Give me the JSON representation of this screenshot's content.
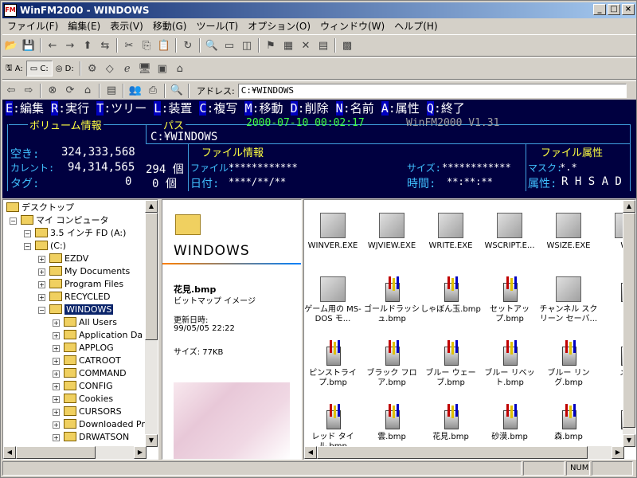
{
  "window": {
    "title": "WinFM2000 - WINDOWS",
    "minimize": "_",
    "maximize": "□",
    "close": "×"
  },
  "menu": [
    "ファイル(F)",
    "編集(E)",
    "表示(V)",
    "移動(G)",
    "ツール(T)",
    "オプション(O)",
    "ウィンドウ(W)",
    "ヘルプ(H)"
  ],
  "drives": {
    "a": "A:",
    "c": "C:",
    "d": "D:"
  },
  "address": {
    "label": "アドレス:",
    "value": "C:¥WINDOWS"
  },
  "commands": [
    {
      "key": "E",
      "label": ":編集"
    },
    {
      "key": "R",
      "label": ":実行"
    },
    {
      "key": "T",
      "label": ":ツリー"
    },
    {
      "key": "L",
      "label": ":装置"
    },
    {
      "key": "C",
      "label": ":複写"
    },
    {
      "key": "M",
      "label": ":移動"
    },
    {
      "key": "D",
      "label": ":削除"
    },
    {
      "key": "N",
      "label": ":名前"
    },
    {
      "key": "A",
      "label": ":属性"
    },
    {
      "key": "Q",
      "label": ":終了"
    }
  ],
  "info": {
    "volume_label": "ボリューム情報",
    "path_label": "パス",
    "datetime": "2000-07-10 00:02:17",
    "version": "WinFM2000 V1.31",
    "path": "C:¥WINDOWS",
    "free_label": "空き:",
    "free_value": "324,333,568",
    "current_label": "カレント:",
    "current_value": "94,314,565",
    "current_count": "294 個",
    "tag_label": "タグ:",
    "tag_value": "0",
    "tag_count": "0 個",
    "fileinfo_label": "ファイル情報",
    "file_label": "ファイル:",
    "file_value": "************",
    "date_label": "日付:",
    "date_value": "****/**/**",
    "size_label": "サイズ:",
    "size_value": "************",
    "time_label": "時間:",
    "time_value": "**:**:**",
    "attr_title": "ファイル属性",
    "mask_label": "マスク:",
    "mask_value": "*.*",
    "attr_label": "属性:",
    "attr_value": "R H S A D"
  },
  "tree": [
    {
      "label": "デスクトップ",
      "level": 0
    },
    {
      "label": "マイ コンピュータ",
      "level": 1
    },
    {
      "label": "3.5 インチ FD (A:)",
      "level": 2
    },
    {
      "label": "(C:)",
      "level": 2
    },
    {
      "label": "EZDV",
      "level": 3
    },
    {
      "label": "My Documents",
      "level": 3
    },
    {
      "label": "Program Files",
      "level": 3
    },
    {
      "label": "RECYCLED",
      "level": 3
    },
    {
      "label": "WINDOWS",
      "level": 3,
      "selected": true
    },
    {
      "label": "All Users",
      "level": 4
    },
    {
      "label": "Application Da",
      "level": 4
    },
    {
      "label": "APPLOG",
      "level": 4
    },
    {
      "label": "CATROOT",
      "level": 4
    },
    {
      "label": "COMMAND",
      "level": 4
    },
    {
      "label": "CONFIG",
      "level": 4
    },
    {
      "label": "Cookies",
      "level": 4
    },
    {
      "label": "CURSORS",
      "level": 4
    },
    {
      "label": "Downloaded Pr",
      "level": 4
    },
    {
      "label": "DRWATSON",
      "level": 4
    }
  ],
  "preview": {
    "folder_name": "WINDOWS",
    "file_name": "花見.bmp",
    "file_type": "ビットマップ イメージ",
    "modified_label": "更新日時:",
    "modified_value": "99/05/05 22:22",
    "size_text": "サイズ: 77KB"
  },
  "files": [
    {
      "name": "WINVER.EXE",
      "type": "exe"
    },
    {
      "name": "WJVIEW.EXE",
      "type": "exe"
    },
    {
      "name": "WRITE.EXE",
      "type": "exe"
    },
    {
      "name": "WSCRIPT.E...",
      "type": "exe"
    },
    {
      "name": "WSIZE.EXE",
      "type": "exe"
    },
    {
      "name": "WU",
      "type": "exe"
    },
    {
      "name": "ゲーム用の MS-DOS モ...",
      "type": "exe"
    },
    {
      "name": "ゴールドラッシュ.bmp",
      "type": "bmp"
    },
    {
      "name": "しゃぼん玉.bmp",
      "type": "bmp"
    },
    {
      "name": "セットアップ.bmp",
      "type": "bmp"
    },
    {
      "name": "チャンネル スクリーン セーバ...",
      "type": "exe"
    },
    {
      "name": "ト",
      "type": "bmp"
    },
    {
      "name": "ピンストライプ.bmp",
      "type": "bmp"
    },
    {
      "name": "ブラック フロア.bmp",
      "type": "bmp"
    },
    {
      "name": "ブルー ウェーブ.bmp",
      "type": "bmp"
    },
    {
      "name": "ブルー リベット.bmp",
      "type": "bmp"
    },
    {
      "name": "ブルー リング.bmp",
      "type": "bmp"
    },
    {
      "name": "メタ",
      "type": "bmp"
    },
    {
      "name": "レッド タイル.bmp",
      "type": "bmp"
    },
    {
      "name": "雲.bmp",
      "type": "bmp"
    },
    {
      "name": "花見.bmp",
      "type": "bmp"
    },
    {
      "name": "砂漠.bmp",
      "type": "bmp"
    },
    {
      "name": "森.bmp",
      "type": "bmp"
    },
    {
      "name": "赤",
      "type": "bmp"
    }
  ],
  "status": {
    "num": "NUM"
  }
}
